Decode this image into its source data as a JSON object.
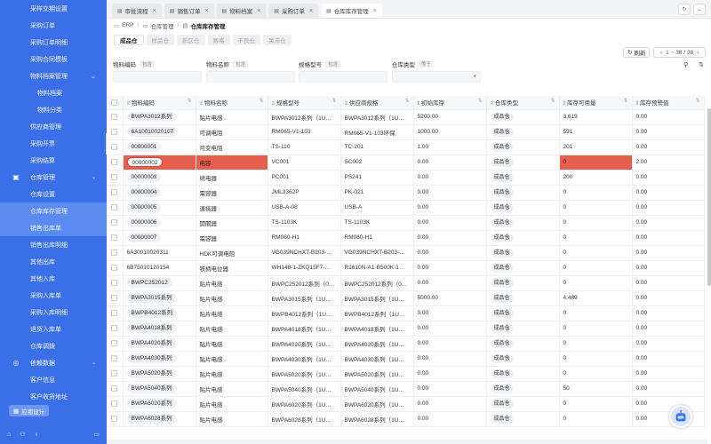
{
  "sidebar": {
    "items": [
      {
        "label": "采样交期设置",
        "kind": "item"
      },
      {
        "label": "采购订单",
        "kind": "item"
      },
      {
        "label": "采购订单明细",
        "kind": "item"
      },
      {
        "label": "采购合同模板",
        "kind": "item"
      },
      {
        "label": "物料档案管理",
        "kind": "item-chev"
      },
      {
        "label": "物料档案",
        "kind": "sub"
      },
      {
        "label": "物料分类",
        "kind": "sub"
      },
      {
        "label": "供应商管理",
        "kind": "item"
      },
      {
        "label": "采购开票",
        "kind": "item"
      },
      {
        "label": "采购结算",
        "kind": "item"
      },
      {
        "label": "仓库管理",
        "kind": "group",
        "icon": "warehouse-icon"
      },
      {
        "label": "仓库设置",
        "kind": "item"
      },
      {
        "label": "仓库库存管理",
        "kind": "item",
        "state": "active"
      },
      {
        "label": "销售出库单",
        "kind": "item",
        "state": "selected"
      },
      {
        "label": "销售出库明细",
        "kind": "item"
      },
      {
        "label": "其他出库",
        "kind": "item"
      },
      {
        "label": "其他入库",
        "kind": "item"
      },
      {
        "label": "采购入库单",
        "kind": "item"
      },
      {
        "label": "采购入库明细",
        "kind": "item"
      },
      {
        "label": "退货入库单",
        "kind": "item"
      },
      {
        "label": "仓库调拨",
        "kind": "item"
      },
      {
        "label": "依赖数据",
        "kind": "group",
        "icon": "database-icon"
      },
      {
        "label": "客户信息",
        "kind": "item"
      },
      {
        "label": "客户收货地址",
        "kind": "item"
      },
      {
        "label": "财务",
        "kind": "item-chev"
      }
    ],
    "ai_button": "应用设计"
  },
  "tabs": [
    {
      "label": "审批流程"
    },
    {
      "label": "销售订单"
    },
    {
      "label": "物料档案"
    },
    {
      "label": "采购订单"
    },
    {
      "label": "仓库库存管理",
      "active": true
    }
  ],
  "breadcrumb": [
    "ERP",
    "仓库管理",
    "仓库库存管理"
  ],
  "chips": [
    {
      "label": "成品仓",
      "active": true
    },
    {
      "label": "样品仓"
    },
    {
      "label": "新区仓"
    },
    {
      "label": "赛格"
    },
    {
      "label": "不良仓"
    },
    {
      "label": "呆滞仓"
    }
  ],
  "toolbar": {
    "refresh": "刷新",
    "pager": "1 ~ 38 / 38"
  },
  "filters": [
    {
      "label": "物料编码",
      "tag": "包含",
      "type": "text"
    },
    {
      "label": "物料名称",
      "tag": "包含",
      "type": "text"
    },
    {
      "label": "规格型号",
      "tag": "包含",
      "type": "text"
    },
    {
      "label": "仓库类型",
      "tag": "等于",
      "type": "select"
    }
  ],
  "table": {
    "columns": [
      {
        "label": "物料编码",
        "icon": "≡"
      },
      {
        "label": "物料名称",
        "icon": "≡"
      },
      {
        "label": "规格型号",
        "icon": "≡"
      },
      {
        "label": "供应商规格",
        "icon": "≡"
      },
      {
        "label": "初始库存",
        "icon": "‖"
      },
      {
        "label": "仓库类型",
        "icon": "≡"
      },
      {
        "label": "库存可用量",
        "icon": "‖"
      },
      {
        "label": "库存预警值",
        "icon": "‖"
      }
    ],
    "rows": [
      {
        "code": "BWPA3012系列",
        "name": "贴片电感",
        "spec": "BWPA3012系列（1U…",
        "vspec": "BWPA3012系列（1U…",
        "init": "5200.00",
        "wh": "成品仓",
        "avail": "3,619",
        "warn": "0.00",
        "pill": true
      },
      {
        "code": "6A10010020107",
        "name": "可调电阻",
        "spec": "RM065-V1-103",
        "vspec": "RM065-V1-103环保",
        "init": "1000.00",
        "wh": "成品仓",
        "avail": "591",
        "warn": "0.00",
        "pill": true
      },
      {
        "code": "00000001",
        "name": "可变电阻",
        "spec": "TS-110",
        "vspec": "TC-201",
        "init": "1.00",
        "wh": "成品仓",
        "avail": "201",
        "warn": "0.00",
        "pill": true
      },
      {
        "code": "00000002",
        "name": "电容",
        "spec": "VC001",
        "vspec": "SC002",
        "init": "0.00",
        "wh": "成品仓",
        "avail": "0",
        "warn": "2.00",
        "pill": true,
        "highlight": true
      },
      {
        "code": "00000003",
        "name": "继电器",
        "spec": "PC001",
        "vspec": "PS241",
        "init": "0.00",
        "wh": "成品仓",
        "avail": "200",
        "warn": "0.00",
        "pill": true
      },
      {
        "code": "00000004",
        "name": "電容器",
        "spec": "JML3362P",
        "vspec": "PK-021",
        "init": "0.00",
        "wh": "成品仓",
        "avail": "0",
        "warn": "0.00",
        "pill": true
      },
      {
        "code": "00000005",
        "name": "連接器",
        "spec": "USB-A-08",
        "vspec": "USB-A",
        "init": "0.00",
        "wh": "成品仓",
        "avail": "0",
        "warn": "0.00",
        "pill": true
      },
      {
        "code": "00000006",
        "name": "開關器",
        "spec": "TS-1103K",
        "vspec": "TS-1103K",
        "init": "0.00",
        "wh": "成品仓",
        "avail": "0",
        "warn": "0.00",
        "pill": true
      },
      {
        "code": "00000007",
        "name": "電容器",
        "spec": "RM060-H1",
        "vspec": "RM060-H1",
        "init": "0.00",
        "wh": "成品仓",
        "avail": "0",
        "warn": "0.00",
        "pill": true
      },
      {
        "code": "6A30010020311",
        "name": "HDK可调电阻",
        "spec": "VG039NCHXT-B203-…",
        "vspec": "VG039NCHXT-B203-…",
        "init": "0.00",
        "wh": "成品仓",
        "avail": "0",
        "warn": "0.00",
        "pill": false
      },
      {
        "code": "6B75010120154",
        "name": "铁柄电位器",
        "spec": "WH148-1-ZKQ15F7-…",
        "vspec": "R1610N-A1-B500K-1…",
        "init": "0.00",
        "wh": "成品仓",
        "avail": "0",
        "warn": "0.00",
        "pill": false
      },
      {
        "code": "BWPC252012",
        "name": "贴片电感",
        "spec": "BWPC252012系列（0…",
        "vspec": "BWPC252012系列（0…",
        "init": "0.00",
        "wh": "成品仓",
        "avail": "0",
        "warn": "0.00",
        "pill": true
      },
      {
        "code": "BWPA3015系列",
        "name": "贴片电感",
        "spec": "BWPA3015系列（1U…",
        "vspec": "BWPA3015系列（1U…",
        "init": "5000.00",
        "wh": "成品仓",
        "avail": "4,489",
        "warn": "0.00",
        "pill": true
      },
      {
        "code": "BWPB4012系列",
        "name": "贴片电感",
        "spec": "BWPB4012系列（1U…",
        "vspec": "BWPB4012系列（1U…",
        "init": "0.00",
        "wh": "成品仓",
        "avail": "0",
        "warn": "0.00",
        "pill": true
      },
      {
        "code": "BWPA4018系列",
        "name": "贴片电感",
        "spec": "BWPA4018系列（1U…",
        "vspec": "BWPA4018系列（1U…",
        "init": "0.00",
        "wh": "成品仓",
        "avail": "0",
        "warn": "0.00",
        "pill": true
      },
      {
        "code": "BWPA4020系列",
        "name": "贴片电感",
        "spec": "BWPA4020系列（1U…",
        "vspec": "BWPA4020系列（1U…",
        "init": "0.00",
        "wh": "成品仓",
        "avail": "0",
        "warn": "0.00",
        "pill": true
      },
      {
        "code": "BWPA4030系列",
        "name": "贴片电感",
        "spec": "BWPA4030系列（1U…",
        "vspec": "BWPA4030系列（1U…",
        "init": "0.00",
        "wh": "成品仓",
        "avail": "0",
        "warn": "0.00",
        "pill": true
      },
      {
        "code": "BWPA5020系列",
        "name": "贴片电感",
        "spec": "BWPA5020系列（1U…",
        "vspec": "BWPA5020系列（1U…",
        "init": "0.00",
        "wh": "成品仓",
        "avail": "0",
        "warn": "0.00",
        "pill": true
      },
      {
        "code": "BWPA5040系列",
        "name": "贴片电感",
        "spec": "BWPA5040系列（1U…",
        "vspec": "BWPA5040系列（1U…",
        "init": "0.00",
        "wh": "成品仓",
        "avail": "50",
        "warn": "0.00",
        "pill": true
      },
      {
        "code": "BWPA6020系列",
        "name": "贴片电感",
        "spec": "BWPA6020系列（1U…",
        "vspec": "BWPA6020系列（1U…",
        "init": "0.00",
        "wh": "成品仓",
        "avail": "0",
        "warn": "0.00",
        "pill": true
      },
      {
        "code": "BWPA6028系列",
        "name": "贴片电感",
        "spec": "BWPA6028系列（1U…",
        "vspec": "BWPA6028系列（1U…",
        "init": "0.00",
        "wh": "成品仓",
        "avail": "0",
        "warn": "0.00",
        "pill": true
      }
    ]
  },
  "colors": {
    "sidebar": "#3b6fe8",
    "highlight": "#e65f4d",
    "accent": "#5b8af0"
  }
}
